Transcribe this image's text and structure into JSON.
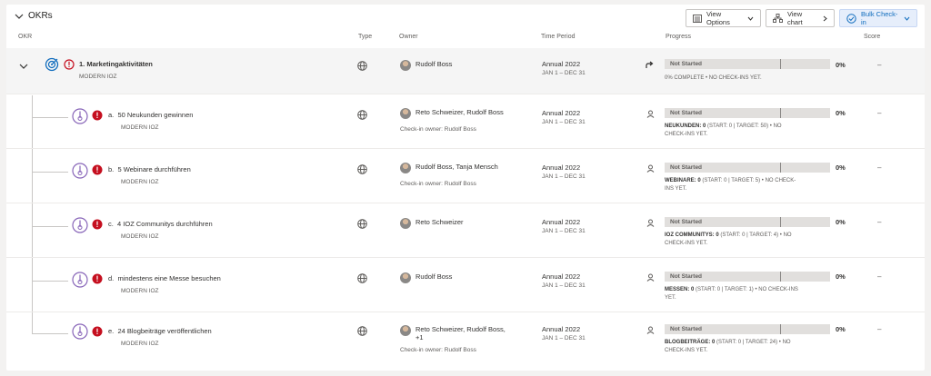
{
  "header": {
    "section_label": "OKRs",
    "view_options_label": "View Options",
    "view_chart_label": "View chart",
    "bulk_checkin_label": "Bulk Check-in"
  },
  "columns": {
    "okr": "OKR",
    "type": "Type",
    "owner": "Owner",
    "time_period": "Time Period",
    "progress": "Progress",
    "score": "Score"
  },
  "objective": {
    "title": "1. Marketingaktivitäten",
    "team": "MODERN IOZ",
    "owner": "Rudolf Boss",
    "period": "Annual 2022",
    "dates": "JAN 1 – DEC 31",
    "status": "Not Started",
    "percent": "0%",
    "progress_text": "0% COMPLETE • NO CHECK-INS YET.",
    "score": "–"
  },
  "key_results": [
    {
      "prefix": "a.",
      "title": "50 Neukunden gewinnen",
      "team": "MODERN IOZ",
      "owner": "Reto Schweizer, Rudolf Boss",
      "owner_extra": "",
      "checkin_owner": "Check-in owner: Rudolf Boss",
      "period": "Annual 2022",
      "dates": "JAN 1 – DEC 31",
      "status": "Not Started",
      "percent": "0%",
      "metric": "NEUKUNDEN: 0",
      "metric_detail": " (START: 0 | TARGET: 50) • NO CHECK-INS YET.",
      "score": "–"
    },
    {
      "prefix": "b.",
      "title": "5 Webinare durchführen",
      "team": "MODERN IOZ",
      "owner": "Rudolf Boss, Tanja Mensch",
      "owner_extra": "",
      "checkin_owner": "Check-in owner: Rudolf Boss",
      "period": "Annual 2022",
      "dates": "JAN 1 – DEC 31",
      "status": "Not Started",
      "percent": "0%",
      "metric": "WEBINARE: 0",
      "metric_detail": " (START: 0 | TARGET: 5) • NO CHECK-INS YET.",
      "score": "–"
    },
    {
      "prefix": "c.",
      "title": "4 IOZ Communitys durchführen",
      "team": "MODERN IOZ",
      "owner": "Reto Schweizer",
      "owner_extra": "",
      "checkin_owner": "",
      "period": "Annual 2022",
      "dates": "JAN 1 – DEC 31",
      "status": "Not Started",
      "percent": "0%",
      "metric": "IOZ COMMUNITYS: 0",
      "metric_detail": " (START: 0 | TARGET: 4) • NO CHECK-INS YET.",
      "score": "–"
    },
    {
      "prefix": "d.",
      "title": "mindestens eine Messe besuchen",
      "team": "MODERN IOZ",
      "owner": "Rudolf Boss",
      "owner_extra": "",
      "checkin_owner": "",
      "period": "Annual 2022",
      "dates": "JAN 1 – DEC 31",
      "status": "Not Started",
      "percent": "0%",
      "metric": "MESSEN: 0",
      "metric_detail": " (START: 0 | TARGET: 1) • NO CHECK-INS YET.",
      "score": "–"
    },
    {
      "prefix": "e.",
      "title": "24 Blogbeiträge veröffentlichen",
      "team": "MODERN IOZ",
      "owner": "Reto Schweizer, Rudolf Boss,",
      "owner_extra": "+1",
      "checkin_owner": "Check-in owner: Rudolf Boss",
      "period": "Annual 2022",
      "dates": "JAN 1 – DEC 31",
      "status": "Not Started",
      "percent": "0%",
      "metric": "BLOGBEITRÄGE: 0",
      "metric_detail": " (START: 0 | TARGET: 24) • NO CHECK-INS YET.",
      "score": "–"
    }
  ],
  "colors": {
    "accent": "#0f6cbd",
    "alert": "#c50f1f",
    "kr_icon": "#8764b8",
    "bar": "#e1dfdd"
  }
}
